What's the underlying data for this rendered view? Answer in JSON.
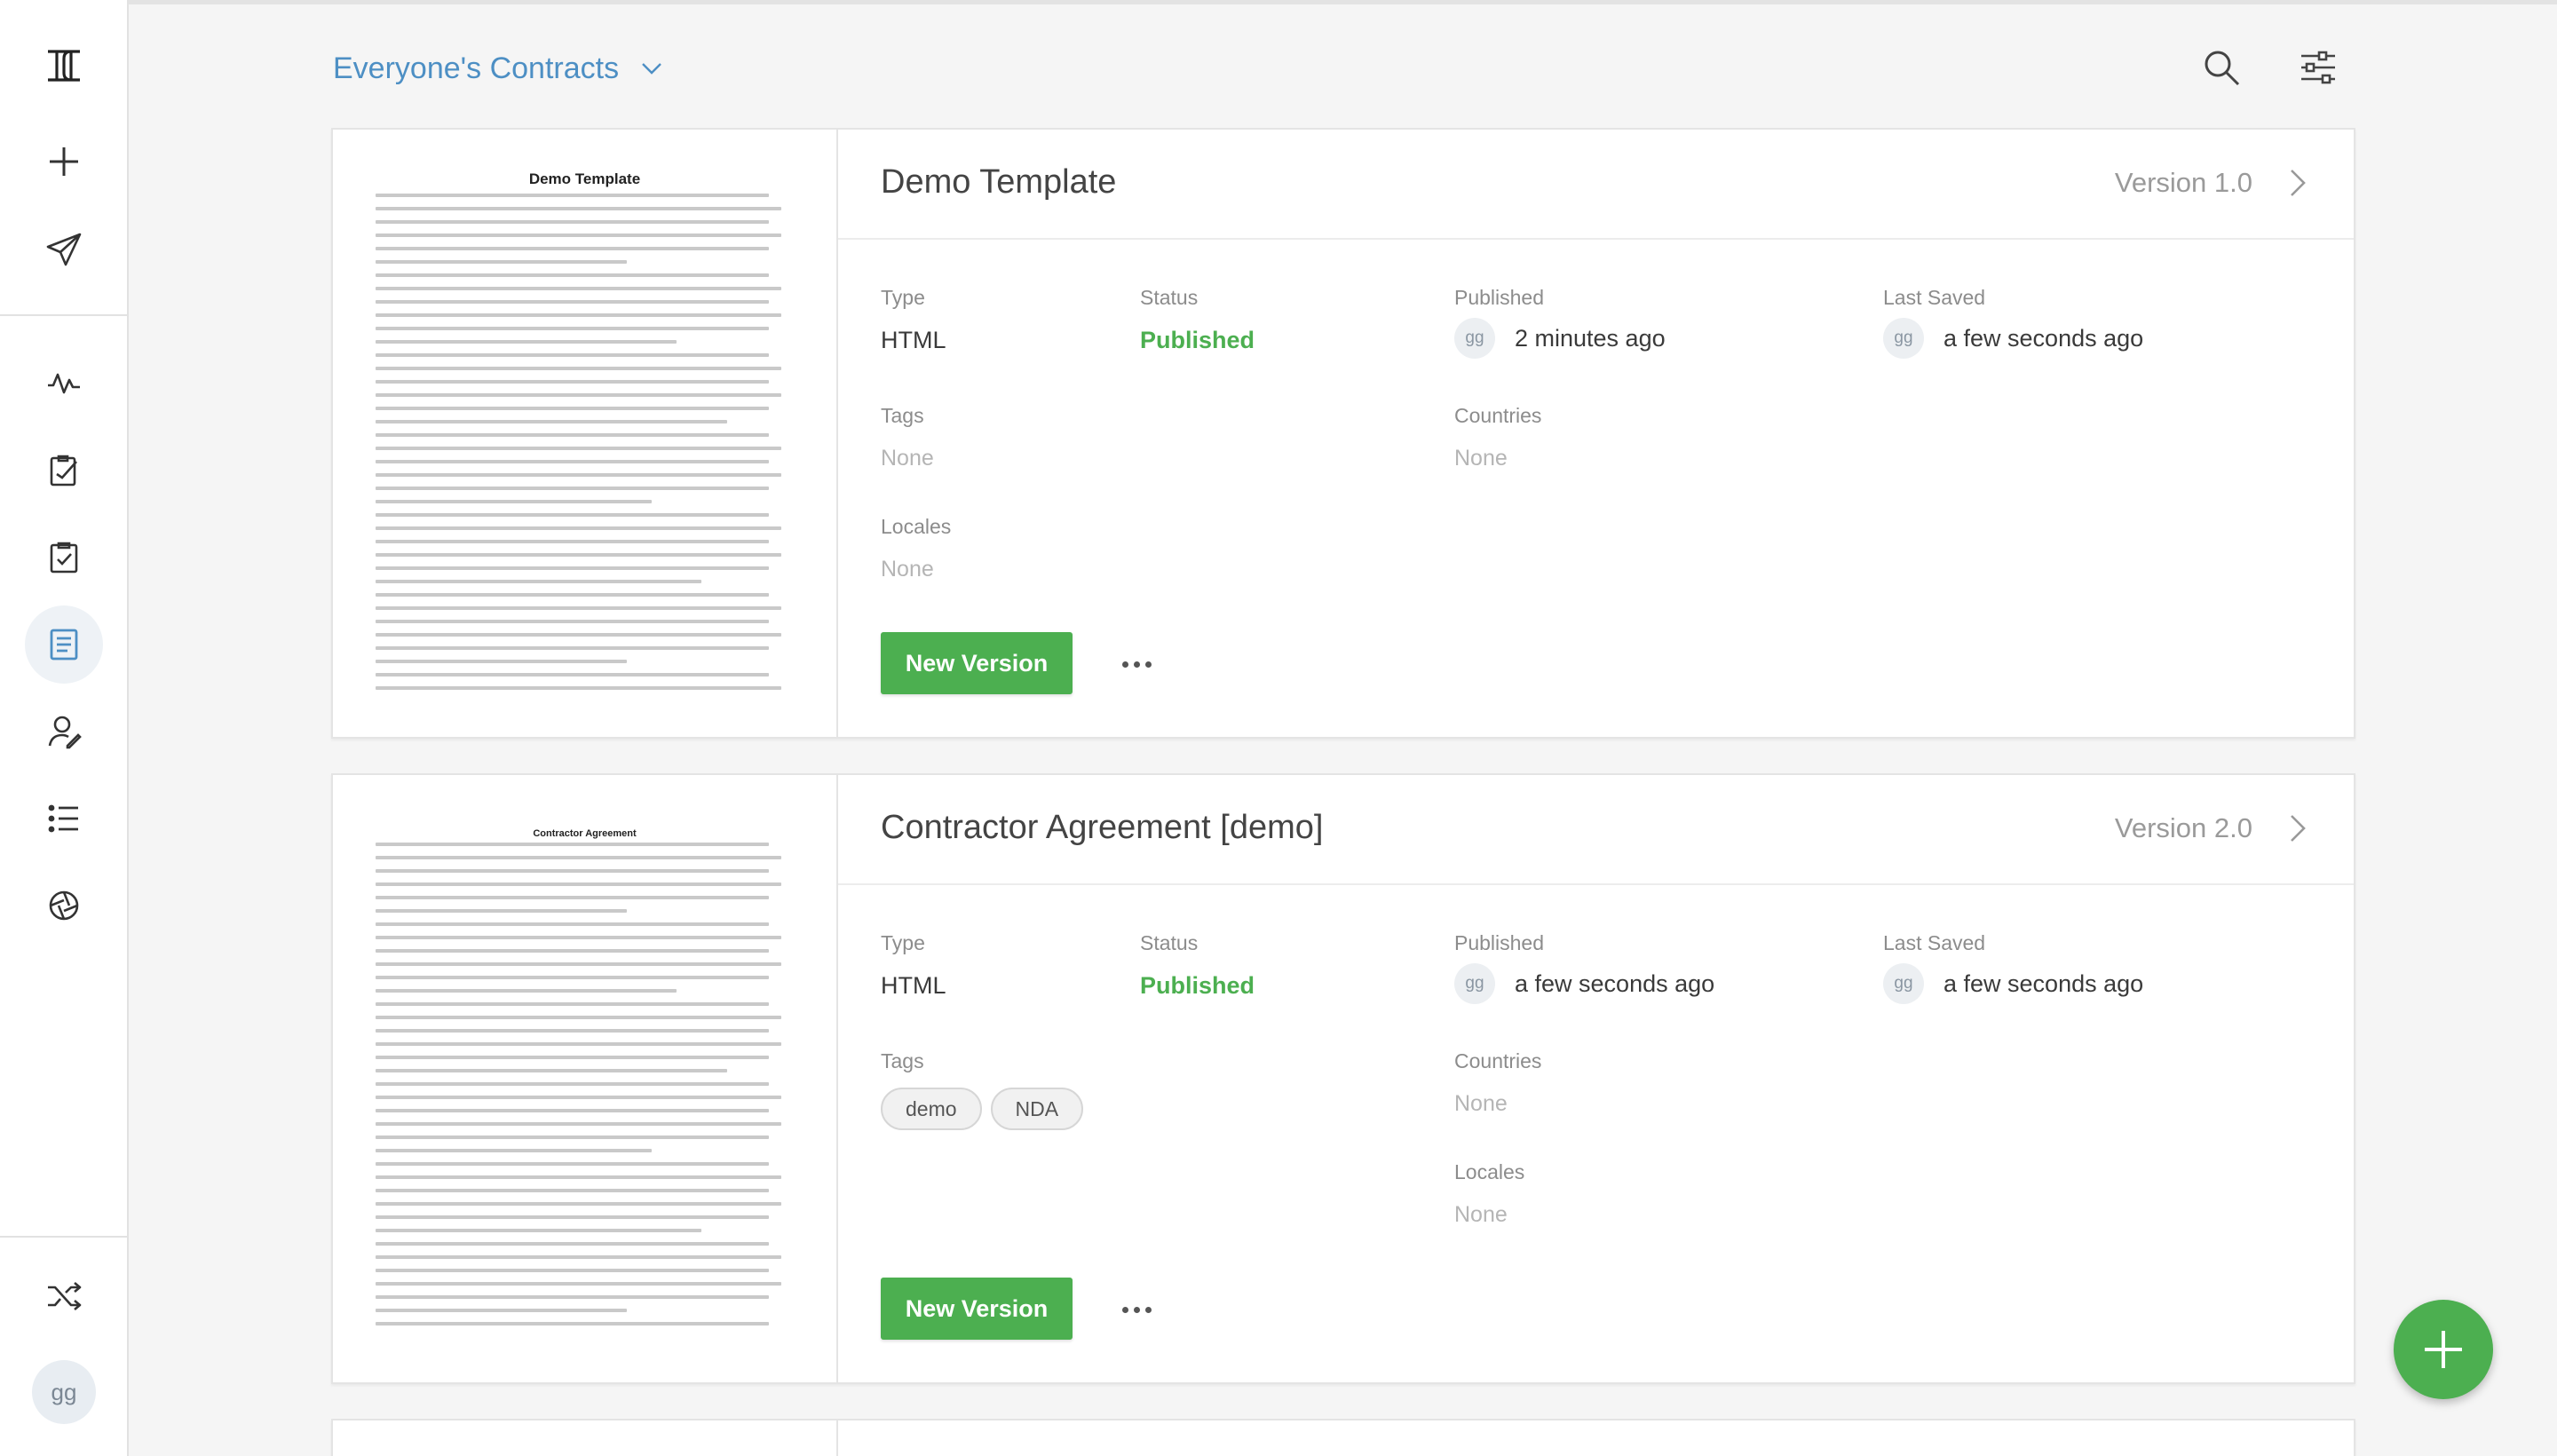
{
  "header": {
    "view_label": "Everyone's Contracts",
    "search_icon": "search-icon",
    "filter_icon": "filter-sliders-icon"
  },
  "sidebar": {
    "items": [
      {
        "icon": "logo-icon"
      },
      {
        "icon": "plus-icon"
      },
      {
        "icon": "send-icon"
      },
      {
        "icon": "activity-icon"
      },
      {
        "icon": "clipboard-edit-icon"
      },
      {
        "icon": "clipboard-check-icon"
      },
      {
        "icon": "document-icon",
        "active": true
      },
      {
        "icon": "user-edit-icon"
      },
      {
        "icon": "list-icon"
      },
      {
        "icon": "aperture-icon"
      },
      {
        "icon": "shuffle-icon"
      }
    ],
    "avatar": "gg"
  },
  "cards": [
    {
      "thumb_title": "Demo Template",
      "title": "Demo Template",
      "version": "Version 1.0",
      "type_label": "Type",
      "type": "HTML",
      "status_label": "Status",
      "status": "Published",
      "published_label": "Published",
      "published_avatar": "gg",
      "published": "2 minutes ago",
      "saved_label": "Last Saved",
      "saved_avatar": "gg",
      "saved": "a few seconds ago",
      "tags_label": "Tags",
      "tags_none": "None",
      "tags": [],
      "countries_label": "Countries",
      "countries": "None",
      "locales_label": "Locales",
      "locales": "None",
      "new_version_label": "New Version"
    },
    {
      "thumb_title": "Contractor Agreement",
      "title": "Contractor Agreement [demo]",
      "version": "Version 2.0",
      "type_label": "Type",
      "type": "HTML",
      "status_label": "Status",
      "status": "Published",
      "published_label": "Published",
      "published_avatar": "gg",
      "published": "a few seconds ago",
      "saved_label": "Last Saved",
      "saved_avatar": "gg",
      "saved": "a few seconds ago",
      "tags_label": "Tags",
      "tags": [
        "demo",
        "NDA"
      ],
      "countries_label": "Countries",
      "countries": "None",
      "locales_label": "Locales",
      "locales": "None",
      "new_version_label": "New Version"
    }
  ],
  "colors": {
    "accent_blue": "#4d8fc4",
    "green": "#4caf50"
  }
}
